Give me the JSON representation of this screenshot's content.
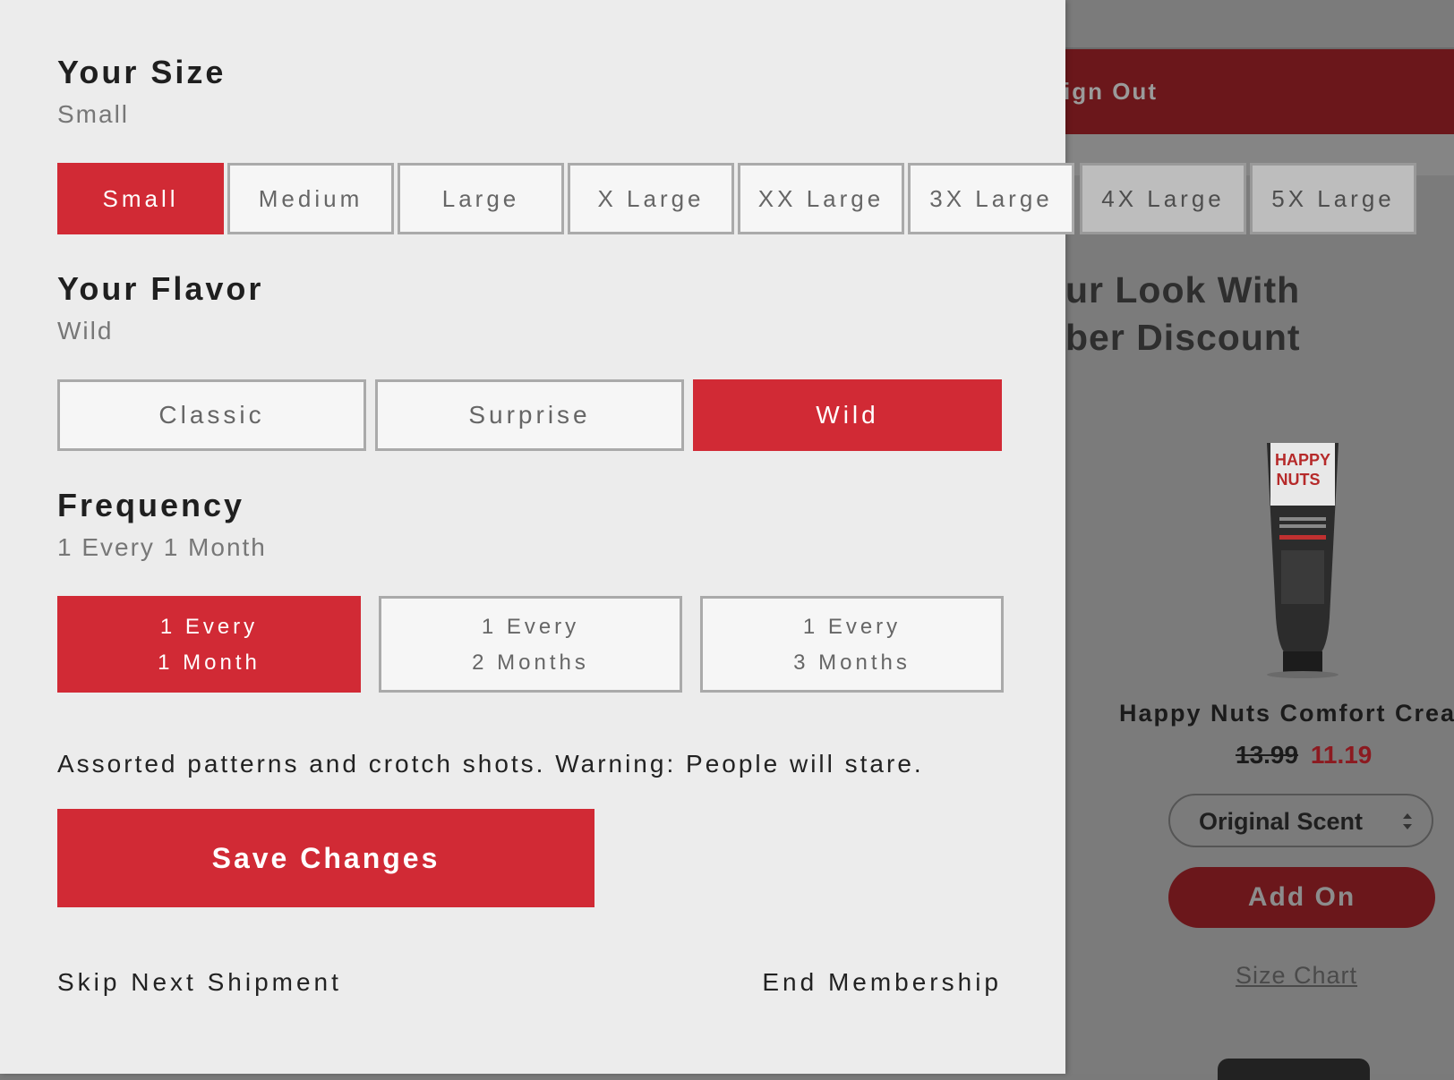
{
  "background_page": {
    "sign_out_label": "ign Out",
    "heading_line1": "ur Look With",
    "heading_line2": "ber Discount",
    "product": {
      "name": "Happy Nuts Comfort Crea",
      "old_price": "13.99",
      "new_price": "11.19",
      "scent_select": "Original Scent",
      "add_on_label": "Add On",
      "size_chart_label": "Size Chart"
    }
  },
  "size": {
    "title": "Your Size",
    "selected": "Small",
    "options": [
      "Small",
      "Medium",
      "Large",
      "X Large",
      "XX Large",
      "3X Large",
      "4X Large",
      "5X Large"
    ]
  },
  "flavor": {
    "title": "Your Flavor",
    "selected": "Wild",
    "options": [
      "Classic",
      "Surprise",
      "Wild"
    ]
  },
  "frequency": {
    "title": "Frequency",
    "selected": "1 Every 1 Month",
    "options": [
      {
        "line1": "1 Every",
        "line2": "1 Month"
      },
      {
        "line1": "1 Every",
        "line2": "2 Months"
      },
      {
        "line1": "1 Every",
        "line2": "3 Months"
      }
    ]
  },
  "description": "Assorted patterns and crotch shots. Warning: People will stare.",
  "save_label": "Save Changes",
  "skip_label": "Skip Next Shipment",
  "end_label": "End Membership",
  "colors": {
    "accent_red": "#d12a35",
    "dark_red": "#6b171b",
    "panel_bg": "#ececec"
  }
}
